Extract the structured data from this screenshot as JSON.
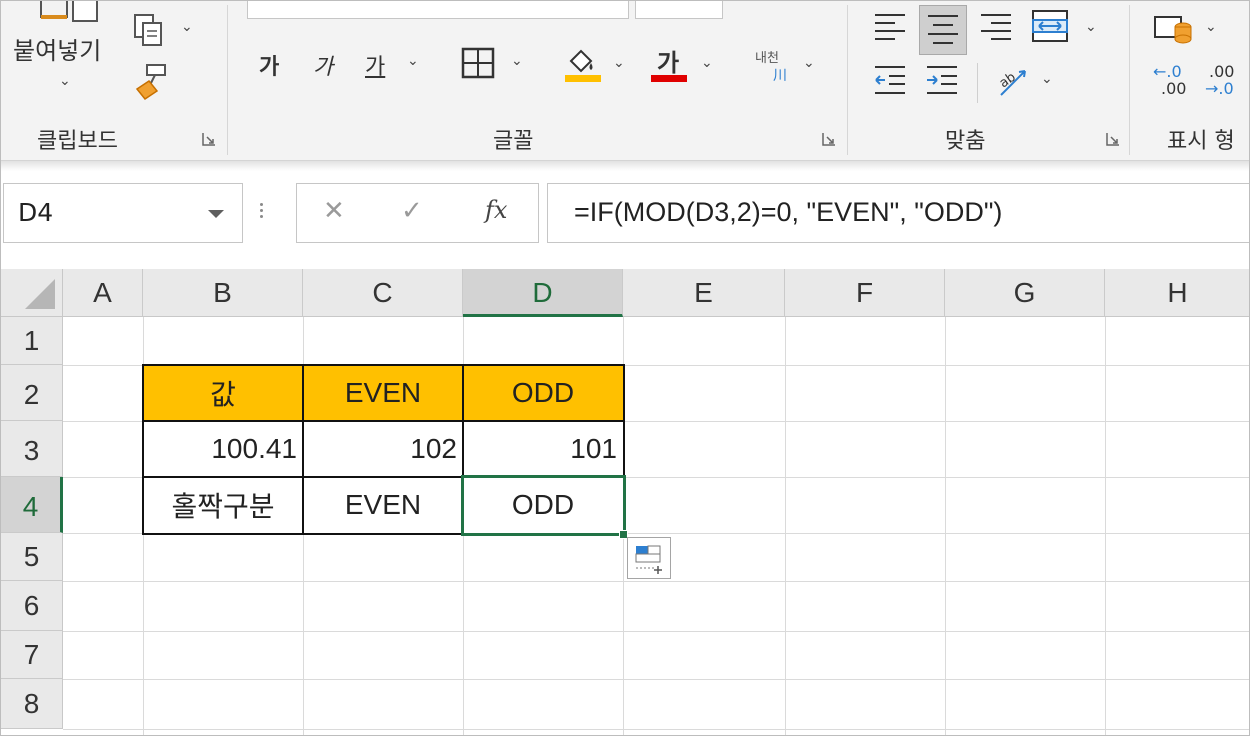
{
  "ribbon": {
    "clipboard": {
      "paste_label": "붙여넣기",
      "group_label": "클립보드"
    },
    "font": {
      "bold_label": "가",
      "italic_label": "가",
      "underline_label": "가",
      "font_color_label": "가",
      "phonetic_top": "내천",
      "phonetic_bottom": "川",
      "group_label": "글꼴",
      "fill_color": "#ffc000",
      "font_color": "#e00000"
    },
    "alignment": {
      "group_label": "맞춤",
      "orientation_label": "ab"
    },
    "number": {
      "group_label": "표시 형",
      "increase_decimal_top": "←.0",
      "increase_decimal_bottom": ".00",
      "decrease_decimal_top": ".00",
      "decrease_decimal_bottom": "→.0"
    }
  },
  "formula_bar": {
    "name_box": "D4",
    "cancel_symbol": "✕",
    "enter_symbol": "✓",
    "fx_label": "fx",
    "formula": "=IF(MOD(D3,2)=0, \"EVEN\", \"ODD\")"
  },
  "sheet": {
    "columns": [
      "A",
      "B",
      "C",
      "D",
      "E",
      "F",
      "G",
      "H"
    ],
    "rows": [
      "1",
      "2",
      "3",
      "4",
      "5",
      "6",
      "7",
      "8"
    ],
    "selected_cell": "D4",
    "cells": {
      "B2": "값",
      "C2": "EVEN",
      "D2": "ODD",
      "B3": "100.41",
      "C3": "102",
      "D3": "101",
      "B4": "홀짝구분",
      "C4": "EVEN",
      "D4": "ODD"
    },
    "header_fill": "#ffc000",
    "selection_color": "#217346"
  }
}
